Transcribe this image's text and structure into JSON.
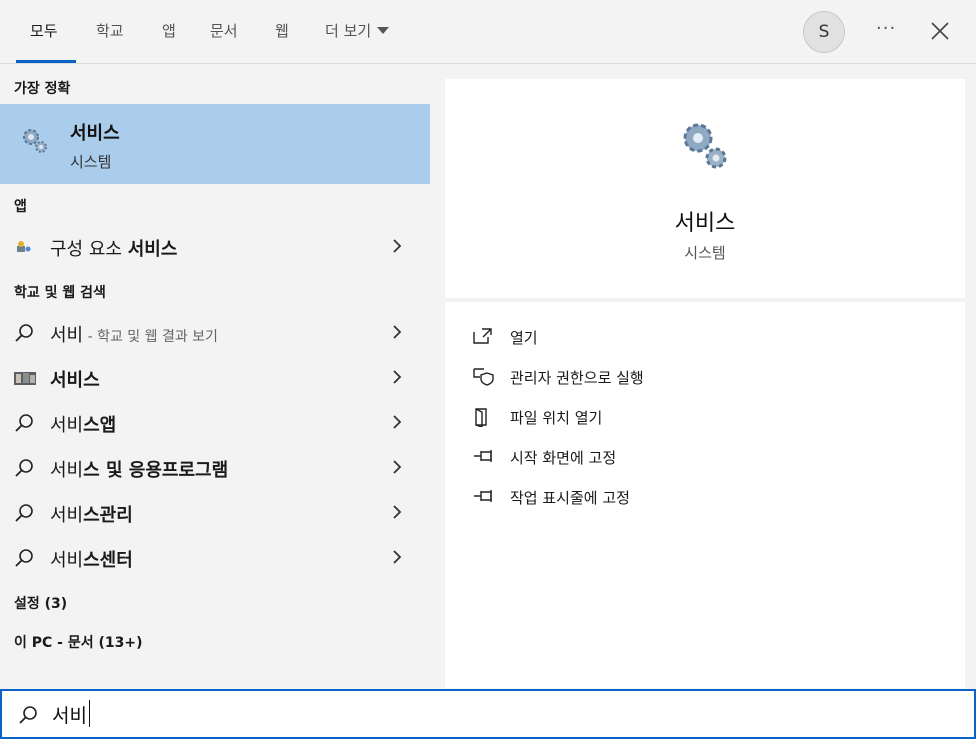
{
  "tabs": [
    {
      "label": "모두"
    },
    {
      "label": "학교"
    },
    {
      "label": "앱"
    },
    {
      "label": "문서"
    },
    {
      "label": "웹"
    },
    {
      "label": "더 보기"
    }
  ],
  "account": {
    "initial": "S"
  },
  "more_options": "···",
  "sections": {
    "best_match": "가장 정확",
    "apps": "앱",
    "web_search": "학교 및 웹 검색",
    "settings": "설정 (3)",
    "this_pc": "이 PC - 문서 (13+)"
  },
  "best_match": {
    "title": "서비스",
    "subtitle": "시스템"
  },
  "apps": [
    {
      "prefix": "구성 요소 ",
      "bold": "서비스"
    }
  ],
  "web_results": [
    {
      "prefix": "서비",
      "bold": "",
      "hint": " - 학교 및 웹 결과 보기",
      "icon": "search-icon"
    },
    {
      "prefix": "",
      "bold": "서비스",
      "hint": "",
      "icon": "image-thumbnail"
    },
    {
      "prefix": "서비",
      "bold": "스앱",
      "hint": "",
      "icon": "search-icon"
    },
    {
      "prefix": "서비",
      "bold": "스 및 응용프로그램",
      "hint": "",
      "icon": "search-icon"
    },
    {
      "prefix": "서비",
      "bold": "스관리",
      "hint": "",
      "icon": "search-icon"
    },
    {
      "prefix": "서비",
      "bold": "스센터",
      "hint": "",
      "icon": "search-icon"
    }
  ],
  "preview": {
    "title": "서비스",
    "subtitle": "시스템",
    "actions": [
      {
        "label": "열기",
        "icon": "open-icon"
      },
      {
        "label": "관리자 권한으로 실행",
        "icon": "shield-icon"
      },
      {
        "label": "파일 위치 열기",
        "icon": "file-location-icon"
      },
      {
        "label": "시작 화면에 고정",
        "icon": "pin-icon"
      },
      {
        "label": "작업 표시줄에 고정",
        "icon": "pin-icon"
      }
    ]
  },
  "search": {
    "value": "서비"
  },
  "colors": {
    "accent": "#0a64c8",
    "selected": "#aacdeb"
  }
}
